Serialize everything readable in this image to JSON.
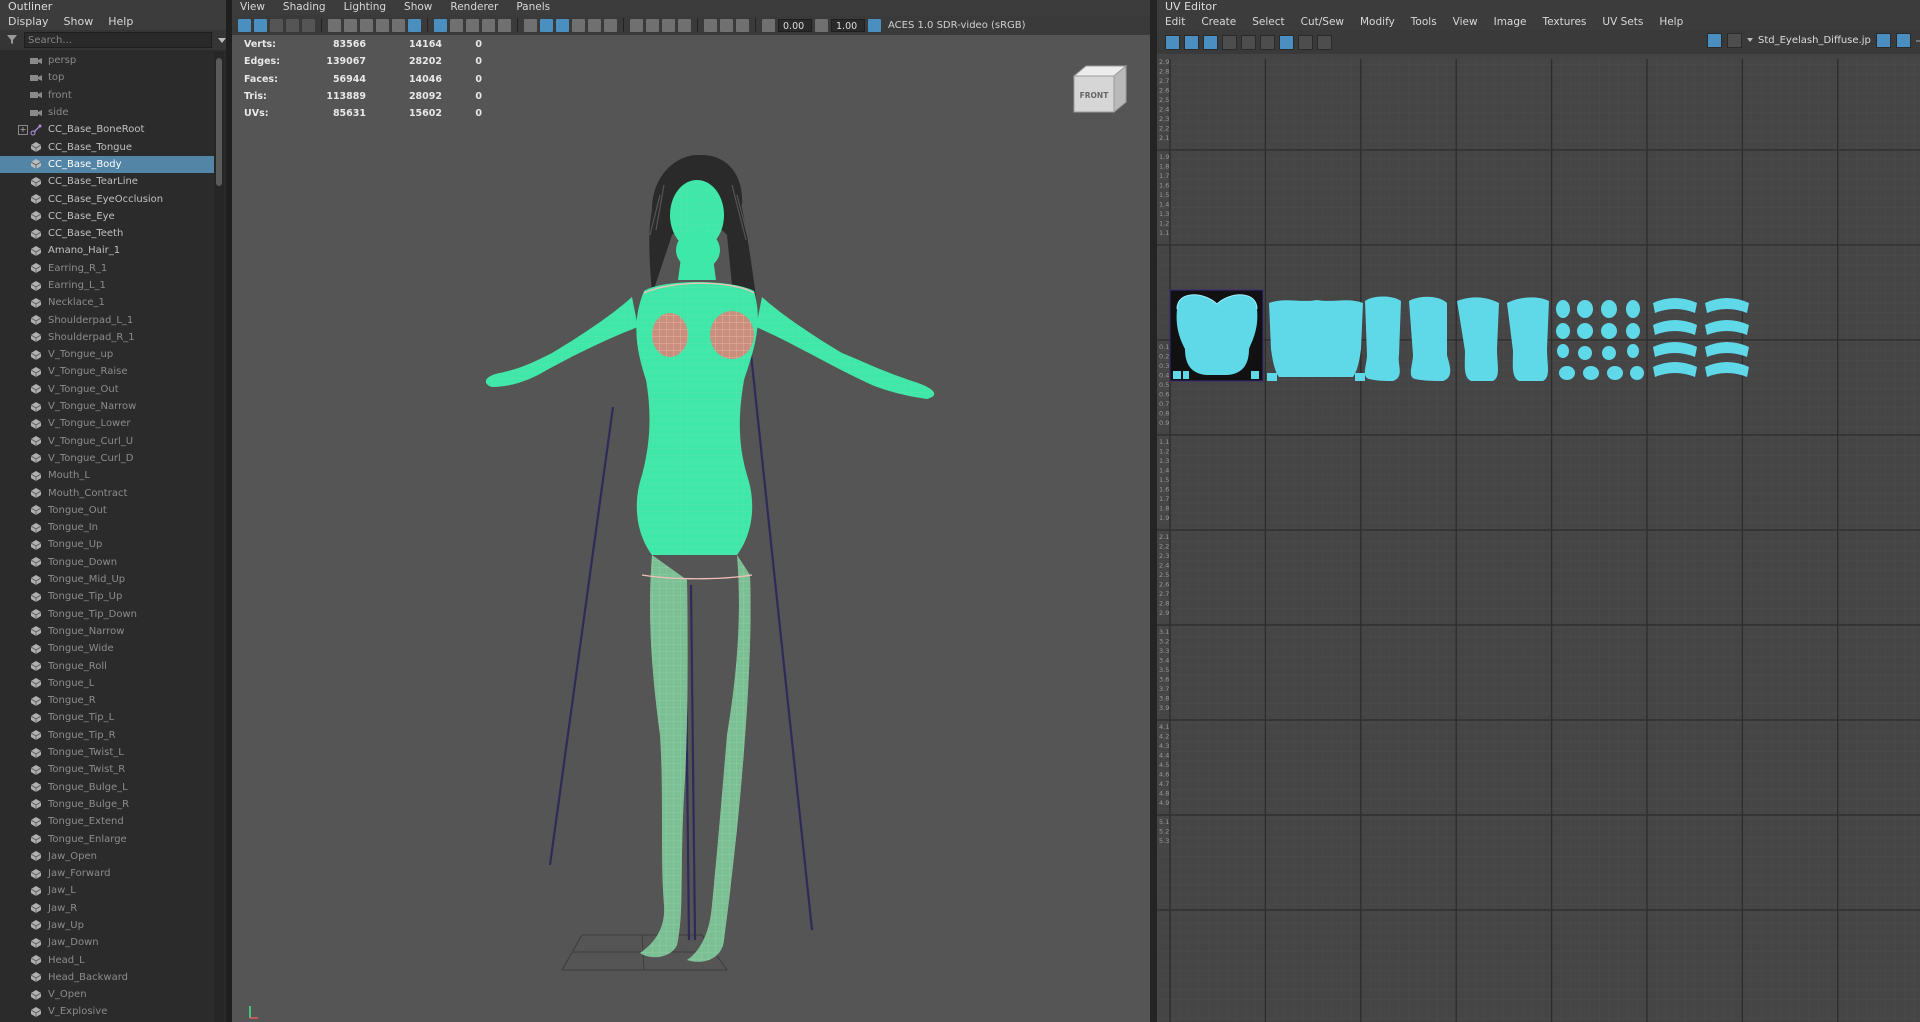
{
  "outliner": {
    "title": "Outliner",
    "menu": [
      "Display",
      "Show",
      "Help"
    ],
    "search_placeholder": "Search...",
    "items": [
      {
        "label": "persp",
        "kind": "camera"
      },
      {
        "label": "top",
        "kind": "camera"
      },
      {
        "label": "front",
        "kind": "camera"
      },
      {
        "label": "side",
        "kind": "camera"
      },
      {
        "label": "CC_Base_BoneRoot",
        "kind": "joint",
        "expand": true
      },
      {
        "label": "CC_Base_Tongue",
        "kind": "mesh"
      },
      {
        "label": "CC_Base_Body",
        "kind": "mesh",
        "selected": true
      },
      {
        "label": "CC_Base_TearLine",
        "kind": "mesh"
      },
      {
        "label": "CC_Base_EyeOcclusion",
        "kind": "mesh"
      },
      {
        "label": "CC_Base_Eye",
        "kind": "mesh"
      },
      {
        "label": "CC_Base_Teeth",
        "kind": "mesh"
      },
      {
        "label": "Amano_Hair_1",
        "kind": "mesh"
      },
      {
        "label": "Earring_R_1",
        "kind": "mesh",
        "dim": true
      },
      {
        "label": "Earring_L_1",
        "kind": "mesh",
        "dim": true
      },
      {
        "label": "Necklace_1",
        "kind": "mesh",
        "dim": true
      },
      {
        "label": "Shoulderpad_L_1",
        "kind": "mesh",
        "dim": true
      },
      {
        "label": "Shoulderpad_R_1",
        "kind": "mesh",
        "dim": true
      },
      {
        "label": "V_Tongue_up",
        "kind": "mesh",
        "dim": true
      },
      {
        "label": "V_Tongue_Raise",
        "kind": "mesh",
        "dim": true
      },
      {
        "label": "V_Tongue_Out",
        "kind": "mesh",
        "dim": true
      },
      {
        "label": "V_Tongue_Narrow",
        "kind": "mesh",
        "dim": true
      },
      {
        "label": "V_Tongue_Lower",
        "kind": "mesh",
        "dim": true
      },
      {
        "label": "V_Tongue_Curl_U",
        "kind": "mesh",
        "dim": true
      },
      {
        "label": "V_Tongue_Curl_D",
        "kind": "mesh",
        "dim": true
      },
      {
        "label": "Mouth_L",
        "kind": "mesh",
        "dim": true
      },
      {
        "label": "Mouth_Contract",
        "kind": "mesh",
        "dim": true
      },
      {
        "label": "Tongue_Out",
        "kind": "mesh",
        "dim": true
      },
      {
        "label": "Tongue_In",
        "kind": "mesh",
        "dim": true
      },
      {
        "label": "Tongue_Up",
        "kind": "mesh",
        "dim": true
      },
      {
        "label": "Tongue_Down",
        "kind": "mesh",
        "dim": true
      },
      {
        "label": "Tongue_Mid_Up",
        "kind": "mesh",
        "dim": true
      },
      {
        "label": "Tongue_Tip_Up",
        "kind": "mesh",
        "dim": true
      },
      {
        "label": "Tongue_Tip_Down",
        "kind": "mesh",
        "dim": true
      },
      {
        "label": "Tongue_Narrow",
        "kind": "mesh",
        "dim": true
      },
      {
        "label": "Tongue_Wide",
        "kind": "mesh",
        "dim": true
      },
      {
        "label": "Tongue_Roll",
        "kind": "mesh",
        "dim": true
      },
      {
        "label": "Tongue_L",
        "kind": "mesh",
        "dim": true
      },
      {
        "label": "Tongue_R",
        "kind": "mesh",
        "dim": true
      },
      {
        "label": "Tongue_Tip_L",
        "kind": "mesh",
        "dim": true
      },
      {
        "label": "Tongue_Tip_R",
        "kind": "mesh",
        "dim": true
      },
      {
        "label": "Tongue_Twist_L",
        "kind": "mesh",
        "dim": true
      },
      {
        "label": "Tongue_Twist_R",
        "kind": "mesh",
        "dim": true
      },
      {
        "label": "Tongue_Bulge_L",
        "kind": "mesh",
        "dim": true
      },
      {
        "label": "Tongue_Bulge_R",
        "kind": "mesh",
        "dim": true
      },
      {
        "label": "Tongue_Extend",
        "kind": "mesh",
        "dim": true
      },
      {
        "label": "Tongue_Enlarge",
        "kind": "mesh",
        "dim": true
      },
      {
        "label": "Jaw_Open",
        "kind": "mesh",
        "dim": true
      },
      {
        "label": "Jaw_Forward",
        "kind": "mesh",
        "dim": true
      },
      {
        "label": "Jaw_L",
        "kind": "mesh",
        "dim": true
      },
      {
        "label": "Jaw_R",
        "kind": "mesh",
        "dim": true
      },
      {
        "label": "Jaw_Up",
        "kind": "mesh",
        "dim": true
      },
      {
        "label": "Jaw_Down",
        "kind": "mesh",
        "dim": true
      },
      {
        "label": "Head_L",
        "kind": "mesh",
        "dim": true
      },
      {
        "label": "Head_Backward",
        "kind": "mesh",
        "dim": true
      },
      {
        "label": "V_Open",
        "kind": "mesh",
        "dim": true
      },
      {
        "label": "V_Explosive",
        "kind": "mesh",
        "dim": true
      }
    ]
  },
  "viewport": {
    "menu": [
      "View",
      "Shading",
      "Lighting",
      "Show",
      "Renderer",
      "Panels"
    ],
    "exposure": "0.00",
    "gamma": "1.00",
    "color_space": "ACES 1.0 SDR-video (sRGB)",
    "hud": [
      {
        "label": "Verts:",
        "total": "83566",
        "selected": "14164",
        "components": "0"
      },
      {
        "label": "Edges:",
        "total": "139067",
        "selected": "28202",
        "components": "0"
      },
      {
        "label": "Faces:",
        "total": "56944",
        "selected": "14046",
        "components": "0"
      },
      {
        "label": "Tris:",
        "total": "113889",
        "selected": "28092",
        "components": "0"
      },
      {
        "label": "UVs:",
        "total": "85631",
        "selected": "15602",
        "components": "0"
      }
    ],
    "viewcube_label": "FRONT",
    "colors": {
      "mesh": "#3ee8a8",
      "wire": "#e88a8a",
      "bones": "#2e2a5a",
      "background": "#555555"
    }
  },
  "uv_editor": {
    "title": "UV Editor",
    "menu": [
      "Edit",
      "Create",
      "Select",
      "Cut/Sew",
      "Modify",
      "Tools",
      "View",
      "Image",
      "Textures",
      "UV Sets",
      "Help"
    ],
    "texture_name": "Std_Eyelash_Diffuse.jp",
    "shell_color": "#5fd8e8",
    "row_labels": [
      [
        "2.9",
        "2.8",
        "2.7",
        "2.6",
        "2.5",
        "2.4",
        "2.3",
        "2.2",
        "2.1"
      ],
      [
        "1.9",
        "1.8",
        "1.7",
        "1.6",
        "1.5",
        "1.4",
        "1.3",
        "1.2",
        "1.1"
      ],
      [],
      [
        "0.1",
        "0.2",
        "0.3",
        "0.4",
        "0.5",
        "0.6",
        "0.7",
        "0.8",
        "0.9"
      ],
      [
        "1.1",
        "1.2",
        "1.3",
        "1.4",
        "1.5",
        "1.6",
        "1.7",
        "1.8",
        "1.9"
      ],
      [
        "2.1",
        "2.2",
        "2.3",
        "2.4",
        "2.5",
        "2.6",
        "2.7",
        "2.8",
        "2.9"
      ],
      [
        "3.1",
        "3.2",
        "3.3",
        "3.4",
        "3.5",
        "3.6",
        "3.7",
        "3.8",
        "3.9"
      ],
      [
        "4.1",
        "4.2",
        "4.3",
        "4.4",
        "4.5",
        "4.6",
        "4.7",
        "4.8",
        "4.9"
      ],
      [
        "5.1",
        "5.2",
        "5.3"
      ]
    ]
  }
}
